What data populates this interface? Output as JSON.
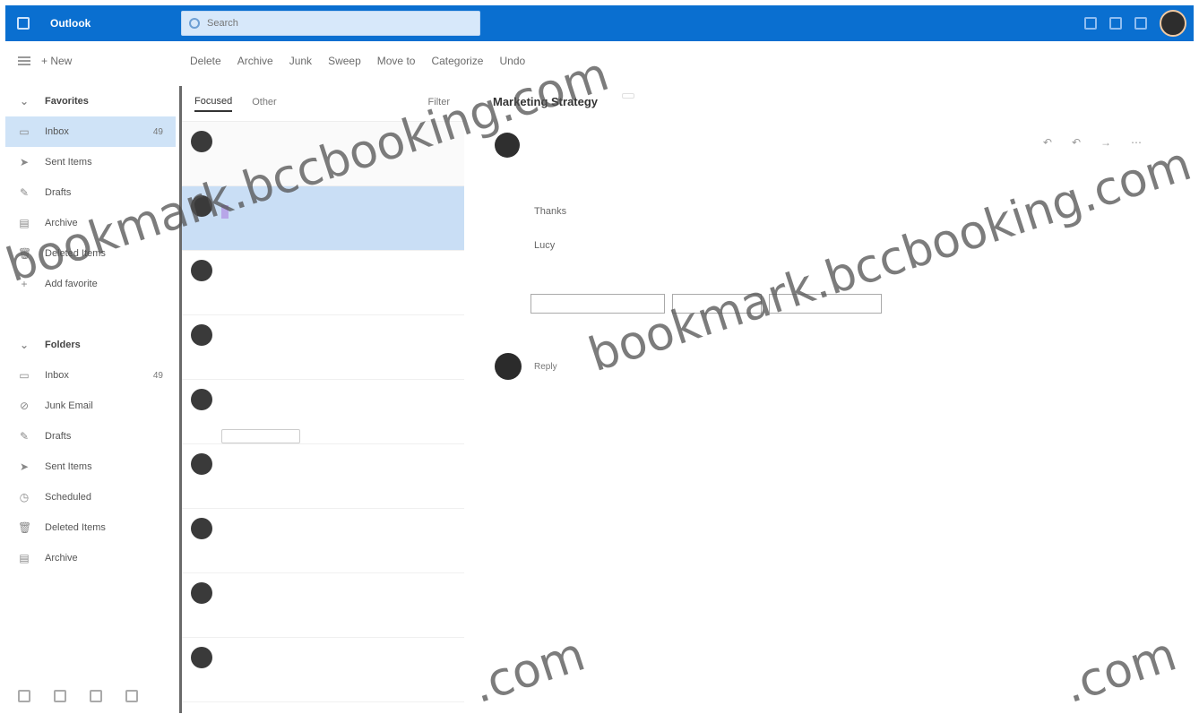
{
  "app": {
    "brand": "Outlook"
  },
  "search": {
    "placeholder": "Search"
  },
  "commands": {
    "new_label": "+ New",
    "items": [
      "Delete",
      "Archive",
      "Junk",
      "Sweep",
      "Move to",
      "Categorize",
      "Undo"
    ]
  },
  "nav": {
    "items": [
      {
        "label": "Favorites",
        "count": "",
        "style": "heading",
        "icon": "chevron"
      },
      {
        "label": "Inbox",
        "count": "49",
        "style": "active",
        "icon": "inbox"
      },
      {
        "label": "Sent Items",
        "count": "",
        "style": "",
        "icon": "send"
      },
      {
        "label": "Drafts",
        "count": "",
        "style": "",
        "icon": "pencil"
      },
      {
        "label": "Archive",
        "count": "",
        "style": "",
        "icon": "archive"
      },
      {
        "label": "Deleted Items",
        "count": "",
        "style": "",
        "icon": "trash"
      },
      {
        "label": "Add favorite",
        "count": "",
        "style": "",
        "icon": "plus"
      },
      {
        "label": "",
        "count": "",
        "style": "muted",
        "icon": ""
      },
      {
        "label": "Folders",
        "count": "",
        "style": "heading",
        "icon": "chevron"
      },
      {
        "label": "Inbox",
        "count": "49",
        "style": "",
        "icon": "inbox"
      },
      {
        "label": "Junk Email",
        "count": "",
        "style": "",
        "icon": "junk"
      },
      {
        "label": "Drafts",
        "count": "",
        "style": "",
        "icon": "pencil"
      },
      {
        "label": "Sent Items",
        "count": "",
        "style": "",
        "icon": "send"
      },
      {
        "label": "Scheduled",
        "count": "",
        "style": "",
        "icon": "clock"
      },
      {
        "label": "Deleted Items",
        "count": "",
        "style": "",
        "icon": "trash"
      },
      {
        "label": "Archive",
        "count": "",
        "style": "",
        "icon": "archive"
      }
    ]
  },
  "list": {
    "tabs": [
      "Focused",
      "Other"
    ],
    "filter_label": "Filter",
    "messages": [
      {
        "sender": "",
        "subject": "",
        "preview": "",
        "time": "",
        "style": "first"
      },
      {
        "sender": "",
        "subject": "",
        "preview": "",
        "time": "",
        "style": "selected"
      },
      {
        "sender": "",
        "subject": "",
        "preview": "",
        "time": "",
        "style": ""
      },
      {
        "sender": "",
        "subject": "",
        "preview": "",
        "time": "",
        "style": ""
      },
      {
        "sender": "",
        "subject": "",
        "preview": "",
        "time": "",
        "style": "attach"
      },
      {
        "sender": "",
        "subject": "",
        "preview": "",
        "time": "",
        "style": ""
      },
      {
        "sender": "",
        "subject": "",
        "preview": "",
        "time": "",
        "style": ""
      },
      {
        "sender": "",
        "subject": "",
        "preview": "",
        "time": "",
        "style": ""
      },
      {
        "sender": "",
        "subject": "",
        "preview": "",
        "time": "",
        "style": ""
      }
    ]
  },
  "reading": {
    "title": "Marketing Strategy",
    "tag": "",
    "sender": "",
    "to": "",
    "body": [
      "",
      "Thanks",
      "Lucy"
    ],
    "reply_label": "Reply"
  },
  "watermark": {
    "text": "bookmark.bccbooking.com",
    "tail": ".com"
  }
}
